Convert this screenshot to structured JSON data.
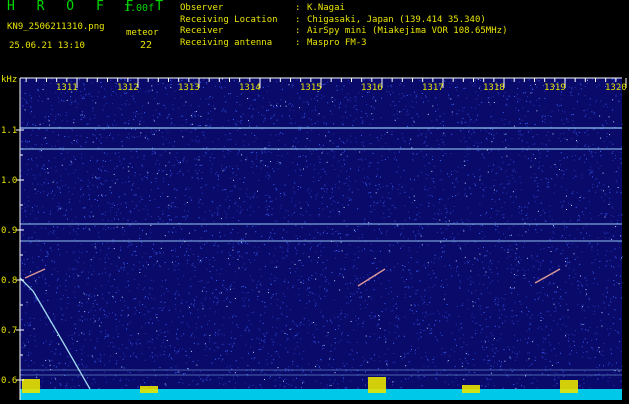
{
  "header": {
    "app_title": "H R O F F T",
    "version": "1.00f",
    "filename": "KN9_2506211310.png",
    "datetime": "25.06.21 13:10",
    "meteor_label": "meteor",
    "meteor_count": "22",
    "info": [
      {
        "key": "Observer",
        "value": "K.Nagai"
      },
      {
        "key": "Receiving Location",
        "value": "Chigasaki, Japan (139.414 35.340)"
      },
      {
        "key": "Receiver",
        "value": "AirSpy mini (Miakejima VOR 108.65MHz)"
      },
      {
        "key": "Receiving antenna",
        "value": "Maspro FM-3"
      }
    ]
  },
  "spectrogram": {
    "y_unit": "kHz",
    "x_ticks": [
      "1311",
      "1312",
      "1313",
      "1314",
      "1315",
      "1316",
      "1317",
      "1318",
      "1319",
      "1320"
    ],
    "y_ticks": [
      "1.1",
      "1.0",
      "0.9",
      "0.8",
      "0.7",
      "0.6"
    ],
    "y_tick_values": [
      1.1,
      1.0,
      0.9,
      0.8,
      0.7,
      0.6
    ],
    "colors": {
      "background": "#0a0a6a",
      "noise": "#3a66ff",
      "axis": "#ffffff",
      "tick_text": "#e8e400",
      "signal": "#9fd8ff",
      "bottom_band": "#00c8e8",
      "spikes": "#e8e400"
    }
  }
}
